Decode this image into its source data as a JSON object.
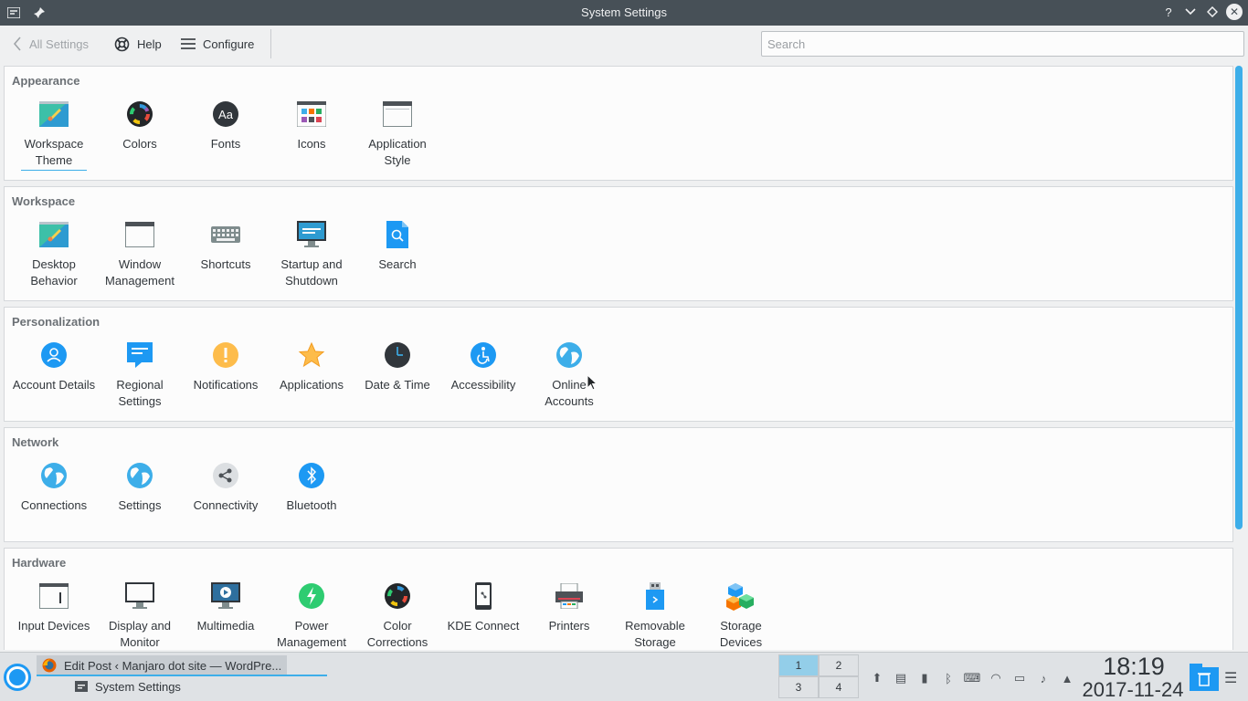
{
  "window": {
    "title": "System Settings"
  },
  "toolbar": {
    "back_label": "All Settings",
    "help_label": "Help",
    "configure_label": "Configure",
    "search_placeholder": "Search"
  },
  "categories": [
    {
      "title": "Appearance",
      "modules": [
        {
          "label": "Workspace Theme",
          "icon": "workspace-theme-icon"
        },
        {
          "label": "Colors",
          "icon": "colors-icon"
        },
        {
          "label": "Fonts",
          "icon": "fonts-icon"
        },
        {
          "label": "Icons",
          "icon": "icons-icon"
        },
        {
          "label": "Application Style",
          "icon": "application-style-icon"
        }
      ]
    },
    {
      "title": "Workspace",
      "modules": [
        {
          "label": "Desktop Behavior",
          "icon": "desktop-behavior-icon"
        },
        {
          "label": "Window Management",
          "icon": "window-management-icon"
        },
        {
          "label": "Shortcuts",
          "icon": "keyboard-icon"
        },
        {
          "label": "Startup and Shutdown",
          "icon": "startup-shutdown-icon"
        },
        {
          "label": "Search",
          "icon": "search-icon"
        }
      ]
    },
    {
      "title": "Personalization",
      "modules": [
        {
          "label": "Account Details",
          "icon": "account-icon"
        },
        {
          "label": "Regional Settings",
          "icon": "regional-icon"
        },
        {
          "label": "Notifications",
          "icon": "notification-icon"
        },
        {
          "label": "Applications",
          "icon": "star-icon"
        },
        {
          "label": "Date & Time",
          "icon": "clock-icon"
        },
        {
          "label": "Accessibility",
          "icon": "accessibility-icon"
        },
        {
          "label": "Online Accounts",
          "icon": "globe-icon"
        }
      ]
    },
    {
      "title": "Network",
      "modules": [
        {
          "label": "Connections",
          "icon": "globe-icon"
        },
        {
          "label": "Settings",
          "icon": "globe-icon"
        },
        {
          "label": "Connectivity",
          "icon": "share-icon"
        },
        {
          "label": "Bluetooth",
          "icon": "bluetooth-icon"
        }
      ]
    },
    {
      "title": "Hardware",
      "modules": [
        {
          "label": "Input Devices",
          "icon": "input-devices-icon"
        },
        {
          "label": "Display and Monitor",
          "icon": "monitor-icon"
        },
        {
          "label": "Multimedia",
          "icon": "multimedia-icon"
        },
        {
          "label": "Power Management",
          "icon": "power-icon"
        },
        {
          "label": "Color Corrections",
          "icon": "color-correction-icon"
        },
        {
          "label": "KDE Connect",
          "icon": "phone-icon"
        },
        {
          "label": "Printers",
          "icon": "printer-icon"
        },
        {
          "label": "Removable Storage",
          "icon": "usb-icon"
        },
        {
          "label": "Storage Devices",
          "icon": "storage-icon"
        }
      ]
    }
  ],
  "taskbar": {
    "tasks": [
      {
        "label": "Edit Post ‹ Manjaro dot site — WordPre...",
        "icon": "firefox-icon"
      },
      {
        "label": "System Settings",
        "icon": "settings-icon"
      }
    ],
    "pager": [
      "1",
      "2",
      "3",
      "4"
    ],
    "clock_time": "18:19",
    "clock_date": "2017-11-24"
  },
  "colors": {
    "accent": "#3daee9",
    "titlebar": "#475057",
    "background": "#eff0f1"
  }
}
